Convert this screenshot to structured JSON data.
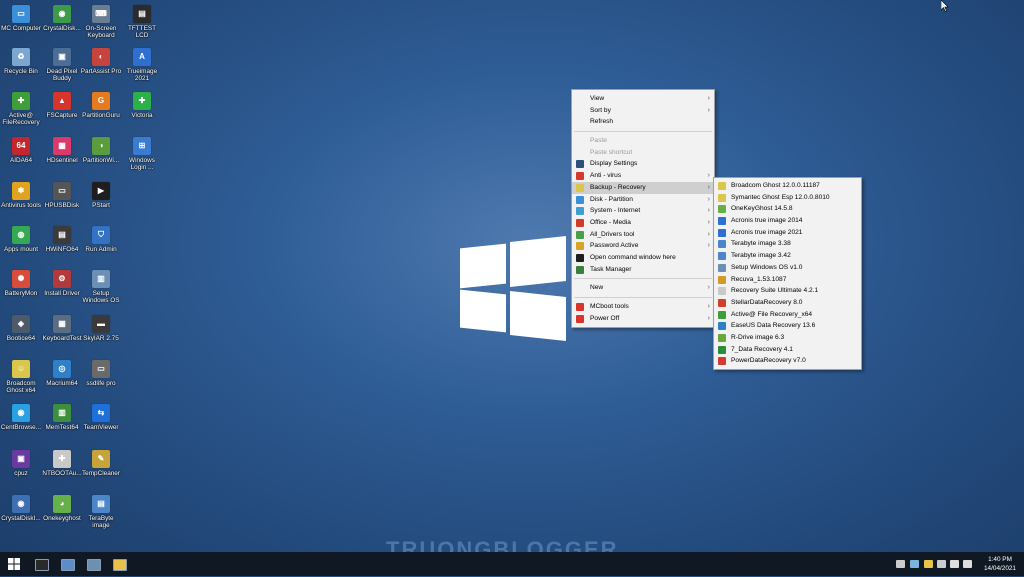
{
  "desktop_icons": [
    {
      "label": "MC Computer",
      "color": "#3a8fd8",
      "glyph": "▭",
      "icon": "computer-icon"
    },
    {
      "label": "CrystalDisk...",
      "color": "#3c9a48",
      "glyph": "◉",
      "icon": "crystaldisk-icon"
    },
    {
      "label": "On-Screen Keyboard",
      "color": "#6a7d94",
      "glyph": "⌨",
      "icon": "keyboard-icon"
    },
    {
      "label": "TFTTEST LCD",
      "color": "#2b2b2b",
      "glyph": "▤",
      "icon": "tfttest-icon"
    },
    {
      "label": "Recycle Bin",
      "color": "#7aa6cf",
      "glyph": "♻",
      "icon": "recycle-bin-icon"
    },
    {
      "label": "Dead Pixel Buddy",
      "color": "#4d6e94",
      "glyph": "▣",
      "icon": "dead-pixel-icon"
    },
    {
      "label": "PartAssist Pro",
      "color": "#c8433c",
      "glyph": "◐",
      "icon": "partassist-icon"
    },
    {
      "label": "Trueimage 2021",
      "color": "#2f6fd1",
      "glyph": "A",
      "icon": "trueimage-icon"
    },
    {
      "label": "Active@ FileRecovery",
      "color": "#3f9e3a",
      "glyph": "✚",
      "icon": "active-filerecovery-icon"
    },
    {
      "label": "FSCapture",
      "color": "#d7342b",
      "glyph": "▲",
      "icon": "fscapture-icon"
    },
    {
      "label": "PartitionGuru",
      "color": "#e57a1f",
      "glyph": "G",
      "icon": "partitionguru-icon"
    },
    {
      "label": "Victoria",
      "color": "#2bb14a",
      "glyph": "✚",
      "icon": "victoria-icon"
    },
    {
      "label": "AIDA64",
      "color": "#c4262e",
      "glyph": "64",
      "icon": "aida64-icon"
    },
    {
      "label": "HDsentinel",
      "color": "#d93a6a",
      "glyph": "▦",
      "icon": "hdsentinel-icon"
    },
    {
      "label": "PartitionWi...",
      "color": "#5b9c3c",
      "glyph": "◑",
      "icon": "partitionwizard-icon"
    },
    {
      "label": "Windows Login ...",
      "color": "#3b7bd1",
      "glyph": "⊞",
      "icon": "windows-login-icon"
    },
    {
      "label": "Antivirus tools",
      "color": "#e0a320",
      "glyph": "✱",
      "icon": "antivirus-icon"
    },
    {
      "label": "HPUSBDisk",
      "color": "#555555",
      "glyph": "▭",
      "icon": "hpusbdisk-icon"
    },
    {
      "label": "PStart",
      "color": "#1e1e1e",
      "glyph": "▶",
      "icon": "pstart-icon"
    },
    {
      "label": "",
      "color": "",
      "glyph": "",
      "icon": ""
    },
    {
      "label": "Apps mount",
      "color": "#35a853",
      "glyph": "◍",
      "icon": "apps-mount-icon"
    },
    {
      "label": "HWiNFO64",
      "color": "#3b3b3b",
      "glyph": "▤",
      "icon": "hwinfo64-icon"
    },
    {
      "label": "Run Admin",
      "color": "#3472c4",
      "glyph": "⛉",
      "icon": "run-admin-icon"
    },
    {
      "label": "",
      "color": "",
      "glyph": "",
      "icon": ""
    },
    {
      "label": "BatteryMon",
      "color": "#d94b3a",
      "glyph": "✺",
      "icon": "batterymon-icon"
    },
    {
      "label": "Install Driver",
      "color": "#b23a3a",
      "glyph": "⚙",
      "icon": "install-driver-icon"
    },
    {
      "label": "Setup Windows OS",
      "color": "#6c8fb5",
      "glyph": "▥",
      "icon": "setup-windows-icon"
    },
    {
      "label": "",
      "color": "",
      "glyph": "",
      "icon": ""
    },
    {
      "label": "Bootice64",
      "color": "#4c5a6a",
      "glyph": "◈",
      "icon": "bootice-icon"
    },
    {
      "label": "KeyboardTest",
      "color": "#5c6d80",
      "glyph": "▦",
      "icon": "keyboardtest-icon"
    },
    {
      "label": "SkyIAR 2.75",
      "color": "#3a3a3a",
      "glyph": "▬",
      "icon": "skyiar-icon"
    },
    {
      "label": "",
      "color": "",
      "glyph": "",
      "icon": ""
    },
    {
      "label": "Broadcom Ghost x64",
      "color": "#d9c64a",
      "glyph": "☺",
      "icon": "broadcom-ghost-icon"
    },
    {
      "label": "Macrium64",
      "color": "#2f7fc9",
      "glyph": "◎",
      "icon": "macrium-icon"
    },
    {
      "label": "ssdlife pro",
      "color": "#6a6a6a",
      "glyph": "▭",
      "icon": "ssdlife-icon"
    },
    {
      "label": "",
      "color": "",
      "glyph": "",
      "icon": ""
    },
    {
      "label": "CentBrowse...",
      "color": "#2aa0e0",
      "glyph": "◉",
      "icon": "centbrowser-icon"
    },
    {
      "label": "MemTest64",
      "color": "#3d8f3d",
      "glyph": "▥",
      "icon": "memtest-icon"
    },
    {
      "label": "TeamViewer",
      "color": "#1e6fd9",
      "glyph": "⇆",
      "icon": "teamviewer-icon"
    },
    {
      "label": "",
      "color": "",
      "glyph": "",
      "icon": ""
    },
    {
      "label": "cpuz",
      "color": "#6b3aa0",
      "glyph": "▣",
      "icon": "cpuz-icon"
    },
    {
      "label": "NTBOOTAu...",
      "color": "#c9c9c9",
      "glyph": "✚",
      "icon": "ntbootautofix-icon"
    },
    {
      "label": "TempCleaner",
      "color": "#c7a43a",
      "glyph": "✎",
      "icon": "tempcleaner-icon"
    },
    {
      "label": "",
      "color": "",
      "glyph": "",
      "icon": ""
    },
    {
      "label": "CrystalDiskI...",
      "color": "#3f6fb3",
      "glyph": "◉",
      "icon": "crystaldiskinfo-icon"
    },
    {
      "label": "Onekeyghost",
      "color": "#66b04a",
      "glyph": "◕",
      "icon": "onekeyghost-icon"
    },
    {
      "label": "TeraByte image",
      "color": "#4c86c9",
      "glyph": "▤",
      "icon": "terabyte-icon"
    }
  ],
  "context_menu": {
    "items": [
      {
        "type": "item",
        "label": "View",
        "arrow": "›",
        "enabled": true,
        "icon": "",
        "color": ""
      },
      {
        "type": "item",
        "label": "Sort by",
        "arrow": "›",
        "enabled": true,
        "icon": "",
        "color": ""
      },
      {
        "type": "item",
        "label": "Refresh",
        "arrow": "",
        "enabled": true,
        "icon": "",
        "color": ""
      },
      {
        "type": "sep"
      },
      {
        "type": "item",
        "label": "Paste",
        "arrow": "",
        "enabled": false,
        "icon": "",
        "color": ""
      },
      {
        "type": "item",
        "label": "Paste shortcut",
        "arrow": "",
        "enabled": false,
        "icon": "",
        "color": ""
      },
      {
        "type": "item",
        "label": "Display Settings",
        "arrow": "",
        "enabled": true,
        "icon": "display-icon",
        "color": "#2c4f7c"
      },
      {
        "type": "item",
        "label": "Anti - virus",
        "arrow": "›",
        "enabled": true,
        "icon": "antivirus-icon",
        "color": "#d33c2c"
      },
      {
        "type": "item",
        "label": "Backup - Recovery",
        "arrow": "›",
        "enabled": true,
        "icon": "backup-icon",
        "color": "#d9c64a",
        "highlight": true
      },
      {
        "type": "item",
        "label": "Disk - Partition",
        "arrow": "›",
        "enabled": true,
        "icon": "disk-icon",
        "color": "#3a8fd8"
      },
      {
        "type": "item",
        "label": "System - Internet",
        "arrow": "›",
        "enabled": true,
        "icon": "globe-icon",
        "color": "#3da0d0"
      },
      {
        "type": "item",
        "label": "Office - Media",
        "arrow": "›",
        "enabled": true,
        "icon": "office-icon",
        "color": "#d23a2b"
      },
      {
        "type": "item",
        "label": "All_Drivers tool",
        "arrow": "›",
        "enabled": true,
        "icon": "drivers-icon",
        "color": "#4aa04a"
      },
      {
        "type": "item",
        "label": "Password Active",
        "arrow": "›",
        "enabled": true,
        "icon": "key-icon",
        "color": "#d9a22b"
      },
      {
        "type": "item",
        "label": "Open command window here",
        "arrow": "",
        "enabled": true,
        "icon": "cmd-icon",
        "color": "#1e1e1e"
      },
      {
        "type": "item",
        "label": "Task Manager",
        "arrow": "",
        "enabled": true,
        "icon": "taskmanager-icon",
        "color": "#3b7f3b"
      },
      {
        "type": "sep"
      },
      {
        "type": "item",
        "label": "New",
        "arrow": "›",
        "enabled": true,
        "icon": "",
        "color": ""
      },
      {
        "type": "sep"
      },
      {
        "type": "item",
        "label": "MCboot tools",
        "arrow": "›",
        "enabled": true,
        "icon": "mcboot-icon",
        "color": "#d9352a"
      },
      {
        "type": "item",
        "label": "Power Off",
        "arrow": "›",
        "enabled": true,
        "icon": "power-icon",
        "color": "#d9352a"
      }
    ]
  },
  "submenu": {
    "items": [
      {
        "label": "Broadcom Ghost 12.0.0.11187",
        "icon": "ghost-icon",
        "color": "#d9c64a"
      },
      {
        "label": "Symantec Ghost Esp 12.0.0.8010",
        "icon": "ghost-icon",
        "color": "#d9c64a"
      },
      {
        "label": "OneKeyGhost 14.5.8",
        "icon": "onekeyghost-icon",
        "color": "#66b04a"
      },
      {
        "label": "Acronis true image 2014",
        "icon": "acronis-icon",
        "color": "#2f6fd1"
      },
      {
        "label": "Acronis true image 2021",
        "icon": "acronis-icon",
        "color": "#2f6fd1"
      },
      {
        "label": "Terabyte image 3.38",
        "icon": "terabyte-icon",
        "color": "#4c86c9"
      },
      {
        "label": "Terabyte image 3.42",
        "icon": "terabyte-icon",
        "color": "#4c86c9"
      },
      {
        "label": "Setup Windows OS v1.0",
        "icon": "setup-icon",
        "color": "#6c8fb5"
      },
      {
        "label": "Recuva_1.53.1087",
        "icon": "recuva-icon",
        "color": "#d39a2a"
      },
      {
        "label": "Recovery Suite Ultimate 4.2.1",
        "icon": "recovery-icon",
        "color": "#c9c9c9"
      },
      {
        "label": "StellarDataRecovery 8.0",
        "icon": "stellar-icon",
        "color": "#d3402a"
      },
      {
        "label": "Active@ File Recovery_x64",
        "icon": "active-icon",
        "color": "#3f9e3a"
      },
      {
        "label": "EaseUS Data Recovery 13.6",
        "icon": "easeus-icon",
        "color": "#2f7fc9"
      },
      {
        "label": "R-Drive image 6.3",
        "icon": "rdrive-icon",
        "color": "#6aa63a"
      },
      {
        "label": "7_Data Recovery 4.1",
        "icon": "7data-icon",
        "color": "#2e8b3a"
      },
      {
        "label": "PowerDataRecovery v7.0",
        "icon": "powerdata-icon",
        "color": "#d33c2c"
      }
    ]
  },
  "taskbar": {
    "apps": [
      {
        "icon": "start-icon",
        "color": "#ffffff"
      },
      {
        "icon": "cmd-icon",
        "color": "#2a2a2a"
      },
      {
        "icon": "computer-icon",
        "color": "#5b8ec7"
      },
      {
        "icon": "network-icon",
        "color": "#6d8fb0"
      },
      {
        "icon": "folder-icon",
        "color": "#e8c24a"
      }
    ],
    "time": "1:40 PM",
    "date": "14/04/2021",
    "tray": [
      {
        "icon": "pen-icon",
        "color": "#cccccc"
      },
      {
        "icon": "usb-icon",
        "color": "#7ab4e0"
      },
      {
        "icon": "monitor-icon",
        "color": "#e8c24a"
      },
      {
        "icon": "network-tray-icon",
        "color": "#cccccc"
      },
      {
        "icon": "volume-icon",
        "color": "#dddddd"
      },
      {
        "icon": "language-icon",
        "color": "#dddddd"
      }
    ]
  },
  "watermark": "TRUONGBLOGGER"
}
